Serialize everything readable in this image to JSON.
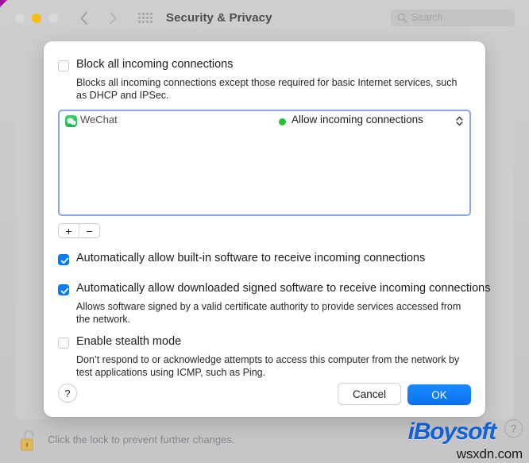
{
  "window": {
    "title": "Security & Privacy",
    "traffic_lights": [
      "close",
      "minimize",
      "zoom"
    ],
    "back_label": "Back",
    "forward_label": "Forward",
    "show_all_label": "Show All"
  },
  "search": {
    "placeholder": "Search"
  },
  "sheet": {
    "block_all": {
      "label": "Block all incoming connections",
      "checked": false,
      "description": "Blocks all incoming connections except those required for basic Internet services, such as DHCP and IPSec."
    },
    "apps_list": {
      "rows": [
        {
          "icon": "wechat-icon",
          "name": "WeChat",
          "status_dot_color": "#21c02f",
          "status": "Allow incoming connections"
        }
      ]
    },
    "add_button_label": "+",
    "remove_button_label": "−",
    "allow_builtin": {
      "label": "Automatically allow built-in software to receive incoming connections",
      "checked": true
    },
    "allow_signed": {
      "label": "Automatically allow downloaded signed software to receive incoming connections",
      "checked": true,
      "description": "Allows software signed by a valid certificate authority to provide services accessed from the network."
    },
    "stealth_mode": {
      "label": "Enable stealth mode",
      "checked": false,
      "description": "Don’t respond to or acknowledge attempts to access this computer from the network by test applications using ICMP, such as Ping."
    },
    "help_label": "?",
    "cancel_label": "Cancel",
    "ok_label": "OK"
  },
  "footer": {
    "lock_caption": "Click the lock to prevent further changes.",
    "help_label": "?"
  },
  "watermarks": {
    "brand": "iBoysoft",
    "site": "wsxdn.com"
  },
  "colors": {
    "accent_blue": "#0a7cf7",
    "focus_ring": "#8aa6e8",
    "status_green": "#21c02f",
    "minimize_yellow": "#f7bb15",
    "brand_blue": "#1364d8"
  }
}
